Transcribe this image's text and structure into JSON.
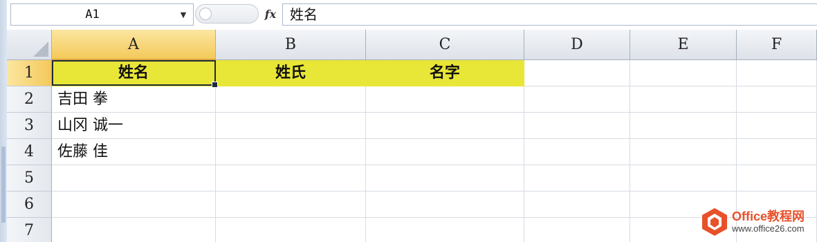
{
  "name_box": {
    "value": "A1"
  },
  "formula_bar": {
    "fx_label": "fx",
    "content": "姓名"
  },
  "columns": [
    {
      "label": "A",
      "active": true
    },
    {
      "label": "B",
      "active": false
    },
    {
      "label": "C",
      "active": false
    },
    {
      "label": "D",
      "active": false
    },
    {
      "label": "E",
      "active": false
    },
    {
      "label": "F",
      "active": false
    }
  ],
  "rows": [
    {
      "label": "1",
      "cells": [
        "姓名",
        "姓氏",
        "名字",
        "",
        "",
        ""
      ]
    },
    {
      "label": "2",
      "cells": [
        "吉田 拳",
        "",
        "",
        "",
        "",
        ""
      ]
    },
    {
      "label": "3",
      "cells": [
        "山冈 诚一",
        "",
        "",
        "",
        "",
        ""
      ]
    },
    {
      "label": "4",
      "cells": [
        "佐藤 佳",
        "",
        "",
        "",
        "",
        ""
      ]
    },
    {
      "label": "5",
      "cells": [
        "",
        "",
        "",
        "",
        "",
        ""
      ]
    },
    {
      "label": "6",
      "cells": [
        "",
        "",
        "",
        "",
        "",
        ""
      ]
    },
    {
      "label": "7",
      "cells": [
        "",
        "",
        "",
        "",
        "",
        ""
      ]
    }
  ],
  "selected_cell": "A1",
  "header_fill_color": "#e8e637",
  "watermark": {
    "title": "Office教程网",
    "url": "www.office26.com"
  }
}
